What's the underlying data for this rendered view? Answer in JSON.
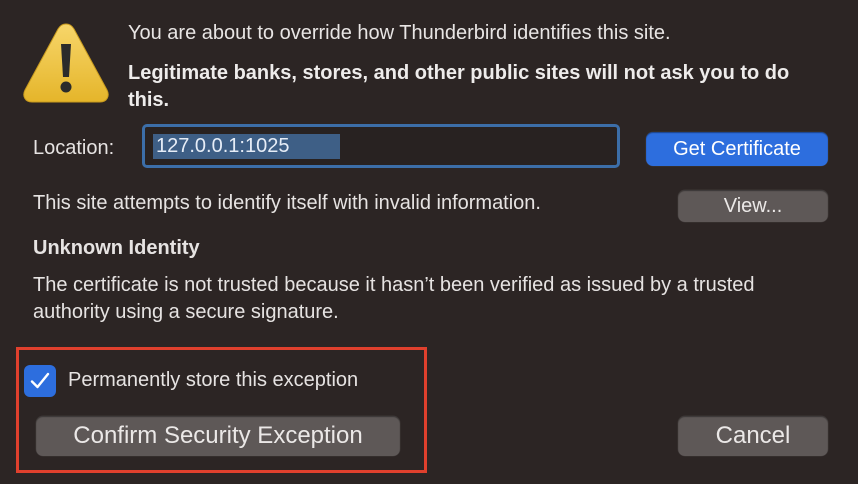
{
  "header": {
    "line1": "You are about to override how Thunderbird identifies this site.",
    "line2": "Legitimate banks, stores, and other public sites will not ask you to do this."
  },
  "icons": {
    "warning": "warning-triangle-icon",
    "checkmark": "checkmark-icon"
  },
  "location": {
    "label": "Location:",
    "value": "127.0.0.1:1025"
  },
  "buttons": {
    "get_certificate": "Get Certificate",
    "view": "View...",
    "confirm": "Confirm Security Exception",
    "cancel": "Cancel"
  },
  "status": {
    "invalid_text": "This site attempts to identify itself with invalid information.",
    "identity_heading": "Unknown Identity",
    "identity_body": "The certificate is not trusted because it hasn’t been verified as issued by a trusted authority using a secure signature."
  },
  "exception": {
    "label": "Permanently store this exception",
    "checked": true
  },
  "colors": {
    "background": "#2c2524",
    "accent": "#2d6ede",
    "highlight": "#e0402d"
  }
}
